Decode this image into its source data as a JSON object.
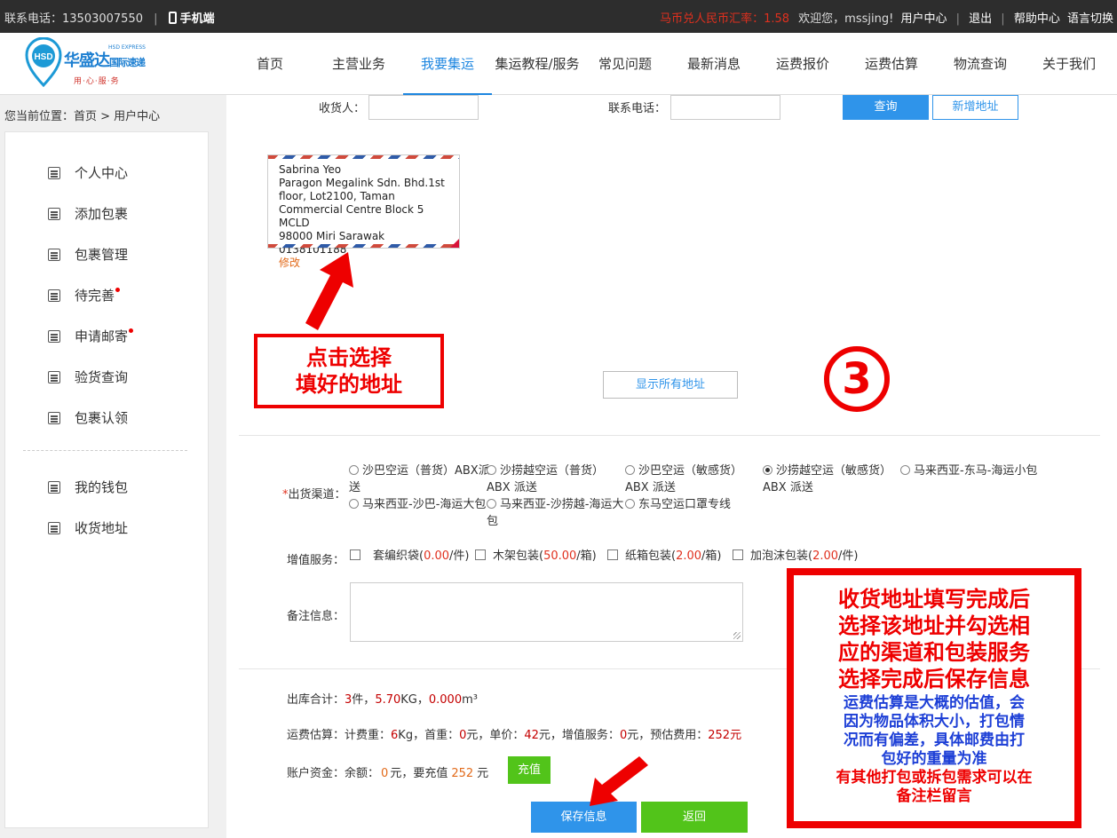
{
  "topbar": {
    "contact_label": "联系电话：13503007550",
    "mobile": "手机端",
    "rate": "马币兑人民币汇率：1.58",
    "welcome": "欢迎您，mssjing!",
    "user_center": "用户中心",
    "logout": "退出",
    "help": "帮助中心",
    "language": "语言切换"
  },
  "logo": {
    "name": "华盛达",
    "sub": "国际速递",
    "en": "HSD EXPRESS",
    "slogan": "用·心·服·务",
    "badge": "HSD"
  },
  "nav": [
    {
      "label": "首页"
    },
    {
      "label": "主营业务"
    },
    {
      "label": "我要集运"
    },
    {
      "label": "集运教程/服务"
    },
    {
      "label": "常见问题"
    },
    {
      "label": "最新消息"
    },
    {
      "label": "运费报价"
    },
    {
      "label": "运费估算"
    },
    {
      "label": "物流查询"
    },
    {
      "label": "关于我们"
    }
  ],
  "breadcrumb": "您当前位置：首页 > 用户中心",
  "sidebar": {
    "items": [
      {
        "label": "个人中心"
      },
      {
        "label": "添加包裹"
      },
      {
        "label": "包裹管理"
      },
      {
        "label": "待完善"
      },
      {
        "label": "申请邮寄"
      },
      {
        "label": "验货查询"
      },
      {
        "label": "包裹认领"
      },
      {
        "label": "我的钱包"
      },
      {
        "label": "收货地址"
      }
    ]
  },
  "search": {
    "receiver_label": "收货人：",
    "phone_label": "联系电话：",
    "query_button": "查询",
    "add_address_button": "新增地址"
  },
  "address_card": {
    "line1": "Sabrina Yeo",
    "line2": "Paragon Megalink Sdn. Bhd.1st",
    "line3": "floor, Lot2100, Taman",
    "line4": "Commercial Centre Block 5 MCLD",
    "line5": "98000 Miri Sarawak 0138101188",
    "edit": "修改"
  },
  "show_all_button": "显示所有地址",
  "channel": {
    "label": "出货渠道：",
    "required_mark": "*",
    "options": [
      {
        "label": "沙巴空运（普货）ABX派送",
        "checked": false
      },
      {
        "label": "沙捞越空运（普货）ABX 派送",
        "checked": false
      },
      {
        "label": "沙巴空运（敏感货）ABX 派送",
        "checked": false
      },
      {
        "label": "沙捞越空运（敏感货）ABX 派送",
        "checked": true
      },
      {
        "label": "马来西亚-东马-海运小包",
        "checked": false
      },
      {
        "label": "马来西亚-沙巴-海运大包",
        "checked": false
      },
      {
        "label": "马来西亚-沙捞越-海运大包",
        "checked": false
      },
      {
        "label": "东马空运口罩专线",
        "checked": false
      }
    ]
  },
  "value_added": {
    "label": "增值服务：",
    "options": [
      {
        "name": "套编织袋(",
        "price": "0.00",
        "unit": "/件)"
      },
      {
        "name": "木架包装(",
        "price": "50.00",
        "unit": "/箱)"
      },
      {
        "name": "纸箱包装(",
        "price": "2.00",
        "unit": "/箱)"
      },
      {
        "name": "加泡沫包装(",
        "price": "2.00",
        "unit": "/件)"
      }
    ]
  },
  "remarks_label": "备注信息：",
  "summary": {
    "outbound_label": "出库合计：",
    "count": "3",
    "count_unit": "件，",
    "weight": "5.70",
    "weight_unit": "KG，",
    "volume": "0.000",
    "volume_unit": "m³",
    "estimate_label": "运费估算：计费重：",
    "charge_weight": "6",
    "charge_weight_unit": "Kg，首重：",
    "first_weight": "0",
    "first_weight_unit": "元，单价：",
    "unit_price": "42",
    "unit_price_unit": "元，增值服务：",
    "vas_fee": "0",
    "vas_fee_unit": "元，预估费用：",
    "estimated": "252",
    "estimated_unit": "元",
    "account_label": "账户资金：",
    "balance_label": "余额：",
    "balance": "0",
    "recharge_mid": "元，要充值",
    "recharge_amount": "252",
    "recharge_unit": "元",
    "recharge_button": "充值"
  },
  "actions": {
    "save": "保存信息",
    "back": "返回"
  },
  "annotations": {
    "note1_line1": "点击选择",
    "note1_line2": "填好的地址",
    "step": "③",
    "note2_red": [
      "收货地址填写完成后",
      "选择该地址并勾选相",
      "应的渠道和包装服务",
      "选择完成后保存信息"
    ],
    "note2_blue": [
      "运费估算是大概的估值，会",
      "因为物品体积大小，打包情",
      "况而有偏差，具体邮费由打",
      "包好的重量为准"
    ],
    "note2_red_small": [
      "有其他打包或拆包需求可以在",
      "备注栏留言"
    ]
  },
  "colors": {
    "accent": "#2f94ea",
    "green": "#52c41a",
    "annotation_red": "#e00000",
    "annotation_blue": "#1d3fd6"
  }
}
